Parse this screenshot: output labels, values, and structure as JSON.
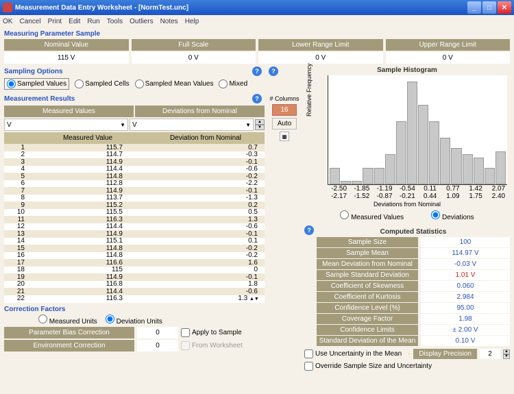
{
  "window": {
    "title": "Measurement Data Entry Worksheet - [NormTest.unc]"
  },
  "menu": {
    "ok": "OK",
    "cancel": "Cancel",
    "print": "Print",
    "edit": "Edit",
    "run": "Run",
    "tools": "Tools",
    "outliers": "Outliers",
    "notes": "Notes",
    "help": "Help"
  },
  "param_section": {
    "title": "Measuring Parameter Sample",
    "nominal": {
      "label": "Nominal Value",
      "value": "115 V"
    },
    "fullscale": {
      "label": "Full Scale",
      "value": "0 V"
    },
    "lower": {
      "label": "Lower Range Limit",
      "value": "0 V"
    },
    "upper": {
      "label": "Upper Range Limit",
      "value": "0 V"
    }
  },
  "sampling": {
    "title": "Sampling Options",
    "values": "Sampled Values",
    "cells": "Sampled Cells",
    "mean": "Sampled Mean Values",
    "mixed": "Mixed"
  },
  "results": {
    "title": "Measurement Results",
    "measured_head": "Measured Values",
    "dev_head": "Deviations from Nominal",
    "unit": "V",
    "col1": "Measured Value",
    "col2": "Deviation from Nominal",
    "rows": [
      {
        "i": "1",
        "m": "115.7",
        "d": "0.7"
      },
      {
        "i": "2",
        "m": "114.7",
        "d": "-0.3"
      },
      {
        "i": "3",
        "m": "114.9",
        "d": "-0.1"
      },
      {
        "i": "4",
        "m": "114.4",
        "d": "-0.6"
      },
      {
        "i": "5",
        "m": "114.8",
        "d": "-0.2"
      },
      {
        "i": "6",
        "m": "112.8",
        "d": "-2.2"
      },
      {
        "i": "7",
        "m": "114.9",
        "d": "-0.1"
      },
      {
        "i": "8",
        "m": "113.7",
        "d": "-1.3"
      },
      {
        "i": "9",
        "m": "115.2",
        "d": "0.2"
      },
      {
        "i": "10",
        "m": "115.5",
        "d": "0.5"
      },
      {
        "i": "11",
        "m": "116.3",
        "d": "1.3"
      },
      {
        "i": "12",
        "m": "114.4",
        "d": "-0.6"
      },
      {
        "i": "13",
        "m": "114.9",
        "d": "-0.1"
      },
      {
        "i": "14",
        "m": "115.1",
        "d": "0.1"
      },
      {
        "i": "15",
        "m": "114.8",
        "d": "-0.2"
      },
      {
        "i": "16",
        "m": "114.8",
        "d": "-0.2"
      },
      {
        "i": "17",
        "m": "116.6",
        "d": "1.6"
      },
      {
        "i": "18",
        "m": "115",
        "d": "0"
      },
      {
        "i": "19",
        "m": "114.9",
        "d": "-0.1"
      },
      {
        "i": "20",
        "m": "116.8",
        "d": "1.8"
      },
      {
        "i": "21",
        "m": "114.4",
        "d": "-0.6"
      },
      {
        "i": "22",
        "m": "116.3",
        "d": "1.3"
      }
    ]
  },
  "columns_ctrl": {
    "label": "# Columns",
    "value": "16",
    "auto": "Auto"
  },
  "histogram": {
    "title": "Sample Histogram",
    "ylabel": "Relative Frequency",
    "xlabel": "Deviations from Nominal",
    "radio_meas": "Measured Values",
    "radio_dev": "Deviations",
    "ticks_top": [
      "-2.50",
      "-1.85",
      "-1.19",
      "-0.54",
      "0.11",
      "0.77",
      "1.42",
      "2.07"
    ],
    "ticks_bot": [
      "-2.17",
      "-1.52",
      "-0.87",
      "-0.21",
      "0.44",
      "1.09",
      "1.75",
      "2.40"
    ]
  },
  "chart_data": {
    "type": "bar",
    "title": "Sample Histogram",
    "xlabel": "Deviations from Nominal",
    "ylabel": "Relative Frequency",
    "ylim": [
      0,
      0.16
    ],
    "categories": [
      "-2.50",
      "-2.17",
      "-1.85",
      "-1.52",
      "-1.19",
      "-0.87",
      "-0.54",
      "-0.21",
      "0.11",
      "0.44",
      "0.77",
      "1.09",
      "1.42",
      "1.75",
      "2.07",
      "2.40"
    ],
    "values": [
      0.025,
      0.005,
      0.005,
      0.025,
      0.025,
      0.045,
      0.095,
      0.155,
      0.12,
      0.095,
      0.07,
      0.055,
      0.045,
      0.04,
      0.025,
      0.05
    ]
  },
  "stats": {
    "title": "Computed Statistics",
    "rows": [
      {
        "label": "Sample Size",
        "value": "100",
        "cls": ""
      },
      {
        "label": "Sample Mean",
        "value": "114.97 V",
        "cls": ""
      },
      {
        "label": "Mean Deviation from Nominal",
        "value": "-0.03 V",
        "cls": ""
      },
      {
        "label": "Sample Standard Deviation",
        "value": "1.01 V",
        "cls": "red"
      },
      {
        "label": "Coefficient of Skewness",
        "value": "0.060",
        "cls": ""
      },
      {
        "label": "Coefficient of Kurtosis",
        "value": "2.984",
        "cls": ""
      },
      {
        "label": "Confidence Level (%)",
        "value": "95.00",
        "cls": ""
      },
      {
        "label": "Coverage Factor",
        "value": "1.98",
        "cls": ""
      },
      {
        "label": "Confidence Limits",
        "value": "± 2.00 V",
        "cls": ""
      },
      {
        "label": "Standard Deviation of the Mean",
        "value": "0.10 V",
        "cls": ""
      }
    ]
  },
  "bottom": {
    "use_unc": "Use Uncertainty in the Mean",
    "override": "Override Sample Size and Uncertainty",
    "disp_prec": "Display Precision",
    "disp_val": "2"
  },
  "corr": {
    "title": "Correction Factors",
    "meas_units": "Measured Units",
    "dev_units": "Deviation Units",
    "bias": "Parameter Bias Correction",
    "env": "Environment Correction",
    "zero": "0",
    "apply": "Apply to Sample",
    "from": "From Worksheet"
  }
}
